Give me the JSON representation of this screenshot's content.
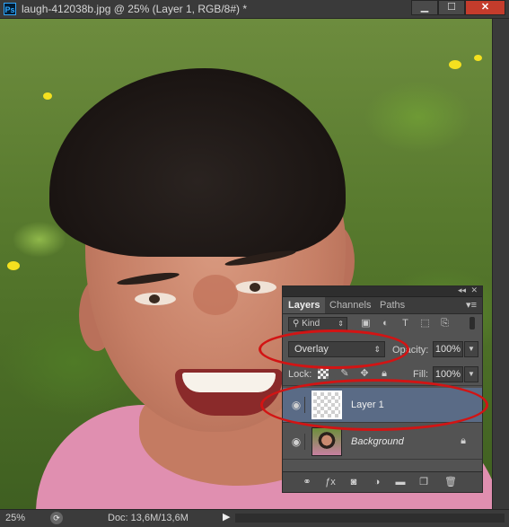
{
  "window": {
    "app_icon": "Ps",
    "title": "laugh-412038b.jpg @ 25% (Layer 1, RGB/8#) *",
    "minimize_icon": "minimize-icon",
    "maximize_icon": "maximize-icon",
    "close_icon": "close-icon"
  },
  "layers_panel": {
    "tabs": [
      {
        "label": "Layers",
        "active": true
      },
      {
        "label": "Channels",
        "active": false
      },
      {
        "label": "Paths",
        "active": false
      }
    ],
    "filter": {
      "kind_label": "Kind"
    },
    "blend_mode": "Overlay",
    "opacity_label": "Opacity:",
    "opacity_value": "100%",
    "lock_label": "Lock:",
    "fill_label": "Fill:",
    "fill_value": "100%",
    "layers": [
      {
        "name": "Layer 1",
        "selected": true,
        "visible": true,
        "thumbnail": "transparent"
      },
      {
        "name": "Background",
        "selected": false,
        "visible": true,
        "thumbnail": "photo",
        "locked": true
      }
    ]
  },
  "status": {
    "zoom": "25%",
    "doc_info": "Doc: 13,6M/13,6M"
  },
  "colors": {
    "annotation_red": "#d21414",
    "selected_layer": "#5a6b86",
    "panel_bg": "#535353"
  }
}
